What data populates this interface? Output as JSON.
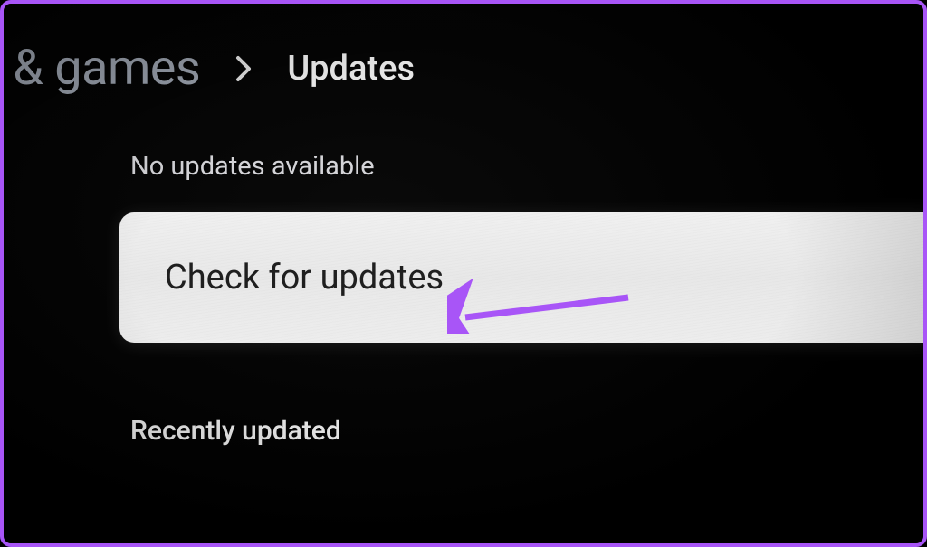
{
  "breadcrumb": {
    "previous_partial": "s & games",
    "current": "Updates"
  },
  "status": {
    "no_updates_label": "No updates available"
  },
  "actions": {
    "check_updates_label": "Check for updates"
  },
  "sections": {
    "recently_updated_label": "Recently updated"
  },
  "annotation": {
    "arrow_color": "#a855f7"
  }
}
